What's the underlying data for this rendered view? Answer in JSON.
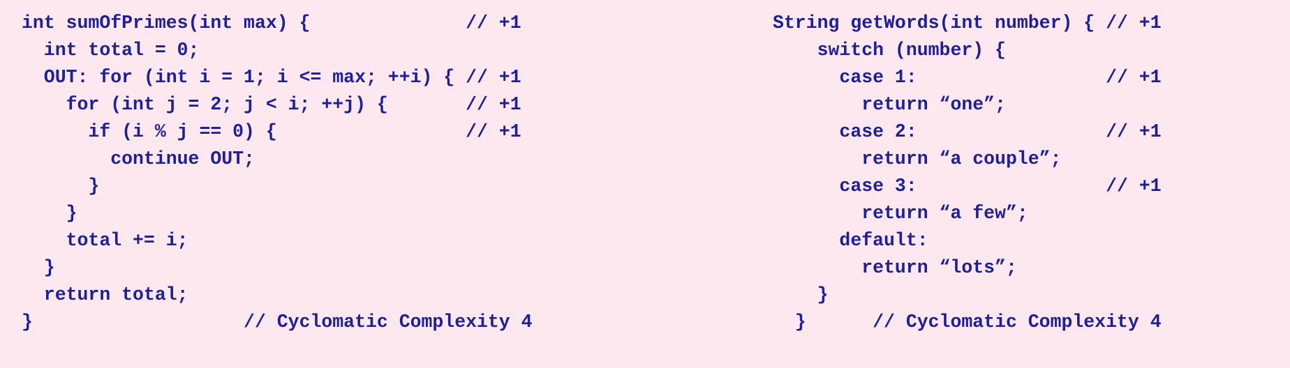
{
  "colors": {
    "background": "#fce8ee",
    "code_text": "#1f1f9a"
  },
  "left_code": {
    "lines": [
      "int sumOfPrimes(int max) {              // +1",
      "  int total = 0;",
      "  OUT: for (int i = 1; i <= max; ++i) { // +1",
      "    for (int j = 2; j < i; ++j) {       // +1",
      "      if (i % j == 0) {                 // +1",
      "        continue OUT;",
      "      }",
      "    }",
      "    total += i;",
      "  }",
      "  return total;",
      "}                   // Cyclomatic Complexity 4"
    ]
  },
  "right_code": {
    "lines": [
      "String getWords(int number) { // +1",
      "    switch (number) {",
      "      case 1:                 // +1",
      "        return “one”;",
      "      case 2:                 // +1",
      "        return “a couple”;",
      "      case 3:                 // +1",
      "        return “a few”;",
      "      default:",
      "        return “lots”;",
      "    }",
      "  }      // Cyclomatic Complexity 4"
    ]
  }
}
